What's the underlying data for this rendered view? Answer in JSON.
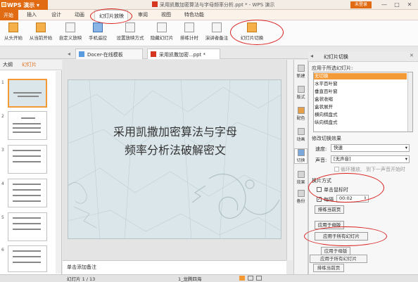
{
  "titlebar": {
    "app_label": "WPS 演示",
    "title": "采用凯撒加密算法与字母频率分析.ppt * - WPS 演示",
    "login_label": "未登录",
    "minimize": "—",
    "maximize": "□",
    "close": "✕"
  },
  "menubar": {
    "items": [
      "开始",
      "插入",
      "设计",
      "动画",
      "幻灯片放映",
      "审阅",
      "视图",
      "特色功能"
    ]
  },
  "ribbon": {
    "buttons": [
      "从头开始",
      "从当前开始",
      "自定义放映",
      "手机遥控",
      "设置放映方式",
      "隐藏幻灯片",
      "排练计时",
      "演讲者备注",
      "幻灯片切换"
    ]
  },
  "tabs": [
    {
      "label": "Docer-在线模板"
    },
    {
      "label": "采用凯撒加密...ppt *"
    }
  ],
  "left_pane": {
    "tab_outline": "大纲",
    "tab_slides": "幻灯片",
    "slide_numbers": [
      "1",
      "2",
      "3",
      "4",
      "5",
      "6"
    ]
  },
  "slide": {
    "title_line1": "采用凯撒加密算法与字母",
    "title_line2": "频率分析法破解密文"
  },
  "notes_placeholder": "单击添加备注",
  "sidebar": {
    "items": [
      "新建",
      "版式",
      "配色",
      "动画",
      "切换",
      "效果",
      "备份"
    ]
  },
  "panel": {
    "title": "幻灯片切换",
    "apply_selected_label": "应用于所选幻灯片:",
    "transitions": [
      "无切换",
      "水平百叶窗",
      "垂直百叶窗",
      "盒状收缩",
      "盒状展开",
      "横向棋盘式",
      "纵向棋盘式"
    ],
    "modify_label": "修改切换效果",
    "speed_label": "速度:",
    "speed_value": "快速",
    "sound_label": "声音:",
    "sound_value": "[无声音]",
    "loop_label": "循环播放,",
    "stop_label": "到下一声音开始时",
    "advance_label": "换片方式",
    "on_click_label": "单击鼠标时",
    "every_label": "每隔",
    "every_value": "00:02",
    "rehearse_label": "排练当前页",
    "apply_master_label": "应用于母版",
    "apply_all_label": "应用于所有幻灯片",
    "ghost_master": "应用于母版",
    "ghost_all": "应用于所有幻灯片",
    "ghost_rehearse": "排练当前页"
  },
  "status": {
    "slide_pos": "幻灯片 1 / 13",
    "theme": "1_龙腾四海"
  }
}
